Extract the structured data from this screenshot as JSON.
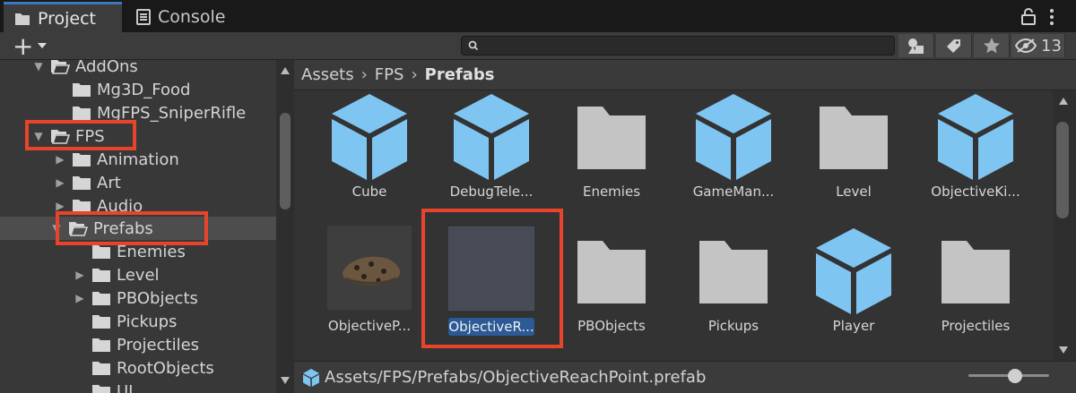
{
  "tabs": [
    {
      "label": "Project"
    },
    {
      "label": "Console"
    }
  ],
  "toolbar": {
    "add_label": "+",
    "search_placeholder": "",
    "hidden_count": "13"
  },
  "tree": [
    {
      "label": "AddOns",
      "expanded": true
    },
    {
      "label": "Mg3D_Food"
    },
    {
      "label": "MgFPS_SniperRifle"
    },
    {
      "label": "FPS",
      "expanded": true
    },
    {
      "label": "Animation"
    },
    {
      "label": "Art"
    },
    {
      "label": "Audio"
    },
    {
      "label": "Prefabs",
      "expanded": true,
      "selected": true
    },
    {
      "label": "Enemies"
    },
    {
      "label": "Level"
    },
    {
      "label": "PBObjects"
    },
    {
      "label": "Pickups"
    },
    {
      "label": "Projectiles"
    },
    {
      "label": "RootObjects"
    },
    {
      "label": "UI"
    }
  ],
  "breadcrumb": [
    "Assets",
    "FPS",
    "Prefabs"
  ],
  "assets": [
    {
      "label": "Cube",
      "kind": "prefab-icon"
    },
    {
      "label": "DebugTele...",
      "kind": "prefab-icon"
    },
    {
      "label": "Enemies",
      "kind": "folder-icon"
    },
    {
      "label": "GameMan...",
      "kind": "prefab-icon"
    },
    {
      "label": "Level",
      "kind": "folder-icon"
    },
    {
      "label": "ObjectiveKi...",
      "kind": "prefab-icon"
    },
    {
      "label": "ObjectiveP...",
      "kind": "preview-thumbnail"
    },
    {
      "label": "ObjectiveR...",
      "kind": "preview-thumbnail",
      "selected": true
    },
    {
      "label": "PBObjects",
      "kind": "folder-icon"
    },
    {
      "label": "Pickups",
      "kind": "folder-icon"
    },
    {
      "label": "Player",
      "kind": "prefab-icon"
    },
    {
      "label": "Projectiles",
      "kind": "folder-icon"
    }
  ],
  "status": {
    "path": "Assets/FPS/Prefabs/ObjectiveReachPoint.prefab"
  },
  "colors": {
    "accent": "#3a79bb",
    "highlight": "#e8442b",
    "prefab": "#7fc5f2",
    "folder": "#c4c4c4",
    "selection": "#2b5a96"
  }
}
